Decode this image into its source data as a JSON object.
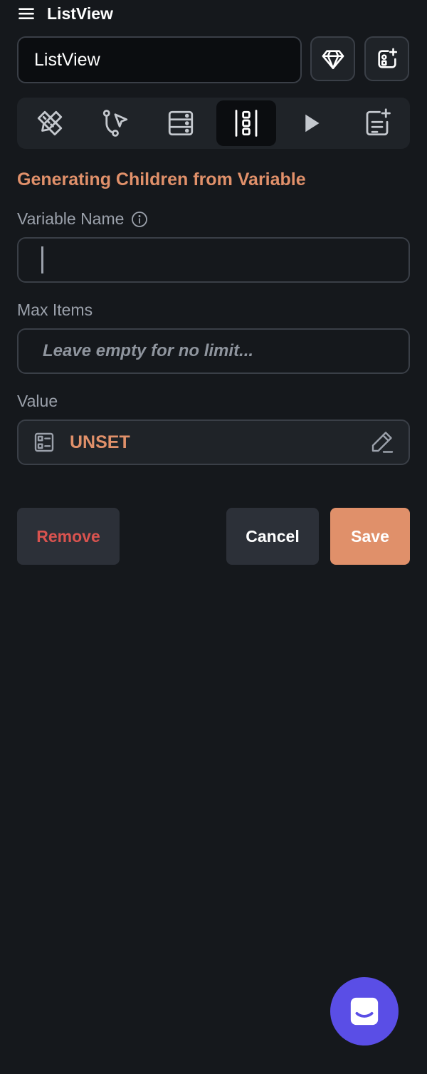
{
  "header": {
    "title": "ListView",
    "menu_icon": "menu-icon"
  },
  "name_field": {
    "value": "ListView"
  },
  "toolbar": {
    "gem_icon": "gem-icon",
    "add_widget_icon": "add-widget-icon"
  },
  "tabs": [
    {
      "icon": "ruler-pencil-icon",
      "active": false
    },
    {
      "icon": "path-cursor-icon",
      "active": false
    },
    {
      "icon": "server-rows-icon",
      "active": false
    },
    {
      "icon": "list-generate-icon",
      "active": true
    },
    {
      "icon": "play-icon",
      "active": false
    },
    {
      "icon": "note-add-icon",
      "active": false
    }
  ],
  "section": {
    "title": "Generating Children from Variable"
  },
  "variable_name": {
    "label": "Variable Name",
    "value": ""
  },
  "max_items": {
    "label": "Max Items",
    "placeholder": "Leave empty for no limit..."
  },
  "value_field": {
    "label": "Value",
    "value": "UNSET"
  },
  "actions": {
    "remove_label": "Remove",
    "cancel_label": "Cancel",
    "save_label": "Save"
  },
  "colors": {
    "accent": "#e0906a",
    "danger": "#d9534f",
    "background": "#15181c",
    "surface": "#1f2328",
    "chat_fab": "#5a4ee6"
  }
}
